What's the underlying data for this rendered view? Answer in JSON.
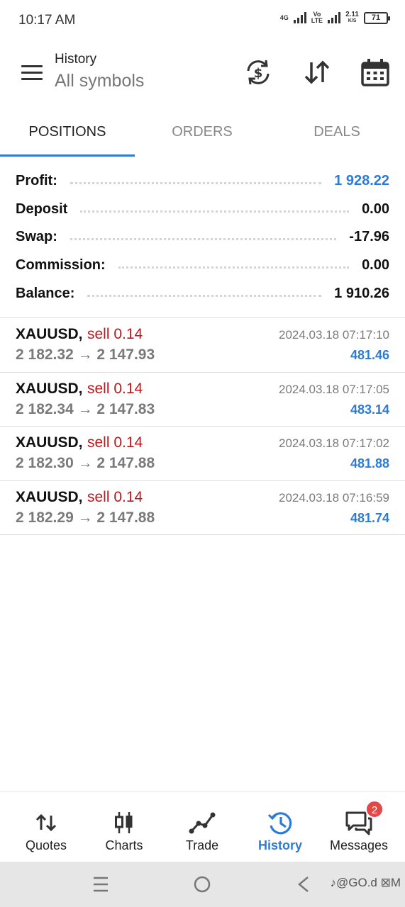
{
  "status_bar": {
    "time": "10:17 AM",
    "network_1": "4G",
    "network_2_top": "Vo",
    "network_2_bottom": "LTE",
    "speed_value": "2.11",
    "speed_unit": "K/S",
    "battery": "71"
  },
  "header": {
    "title": "History",
    "subtitle": "All symbols"
  },
  "tabs": [
    {
      "label": "POSITIONS",
      "active": true
    },
    {
      "label": "ORDERS",
      "active": false
    },
    {
      "label": "DEALS",
      "active": false
    }
  ],
  "summary": [
    {
      "label": "Profit:",
      "value": "1 928.22"
    },
    {
      "label": "Deposit",
      "value": "0.00"
    },
    {
      "label": "Swap:",
      "value": "-17.96"
    },
    {
      "label": "Commission:",
      "value": "0.00"
    },
    {
      "label": "Balance:",
      "value": "1 910.26"
    }
  ],
  "positions": [
    {
      "symbol": "XAUUSD,",
      "side": "sell 0.14",
      "prices": "2 182.32 → 2 147.93",
      "time": "2024.03.18 07:17:10",
      "profit": "481.46"
    },
    {
      "symbol": "XAUUSD,",
      "side": "sell 0.14",
      "prices": "2 182.34 → 2 147.83",
      "time": "2024.03.18 07:17:05",
      "profit": "483.14"
    },
    {
      "symbol": "XAUUSD,",
      "side": "sell 0.14",
      "prices": "2 182.30 → 2 147.88",
      "time": "2024.03.18 07:17:02",
      "profit": "481.88"
    },
    {
      "symbol": "XAUUSD,",
      "side": "sell 0.14",
      "prices": "2 182.29 → 2 147.88",
      "time": "2024.03.18 07:16:59",
      "profit": "481.74"
    }
  ],
  "bottom_nav": [
    {
      "label": "Quotes",
      "icon": "quotes-arrows-icon",
      "active": false
    },
    {
      "label": "Charts",
      "icon": "candlestick-icon",
      "active": false
    },
    {
      "label": "Trade",
      "icon": "trade-line-icon",
      "active": false
    },
    {
      "label": "History",
      "icon": "history-clock-icon",
      "active": true
    },
    {
      "label": "Messages",
      "icon": "chat-bubbles-icon",
      "active": false,
      "badge": "2"
    }
  ],
  "watermark": "♪@GO.d ⊠M",
  "colors": {
    "accent": "#2e7bd6",
    "sell": "#c0161c",
    "muted": "#7a7a7a",
    "badge": "#e34848"
  }
}
